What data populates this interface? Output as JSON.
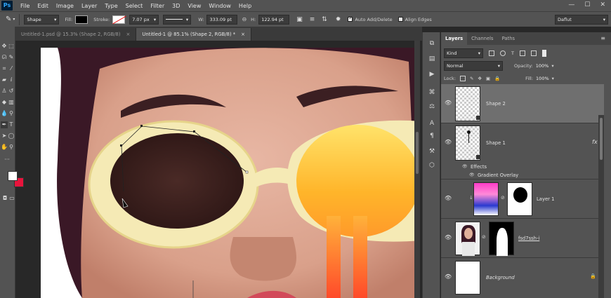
{
  "app": {
    "logo": "Ps",
    "menu": [
      "File",
      "Edit",
      "Image",
      "Layer",
      "Type",
      "Select",
      "Filter",
      "3D",
      "View",
      "Window",
      "Help"
    ],
    "window_controls": [
      "—",
      "☐",
      "✕"
    ]
  },
  "options_bar": {
    "tool_mode": "Shape",
    "fill_label": "Fill:",
    "fill_color": "#000000",
    "stroke_label": "Stroke:",
    "stroke_width": "7.07 px",
    "w_label": "W:",
    "w_value": "333.09 pt",
    "h_label": "H:",
    "h_value": "122.94 pt",
    "auto_add_delete": "Auto Add/Delete",
    "align_edges": "Align Edges",
    "workspace": "Daflut"
  },
  "tabs": [
    {
      "label": "Untitled-1.psd @ 15.3% (Shape 2, RGB/8)",
      "close": "×",
      "active": false
    },
    {
      "label": "Untitled-1 @ 85.1% (Shape 2, RGB/8) *",
      "close": "×",
      "active": true
    }
  ],
  "layers_panel": {
    "tabs": [
      "Layers",
      "Channels",
      "Paths"
    ],
    "menu_icon": "≡",
    "filter_kind": "Kind",
    "blend_mode": "Normal",
    "opacity_label": "Opacity:",
    "opacity_value": "100%",
    "lock_label": "Lock:",
    "fill_label": "Fill:",
    "fill_value": "100%",
    "layers": [
      {
        "name": "Shape 2",
        "selected": true
      },
      {
        "name": "Shape 1",
        "fx": "fx",
        "effects_label": "Effects",
        "effect": "Gradient Overlay"
      },
      {
        "name": "Layer 1"
      },
      {
        "name": "fsd7ssh-i"
      },
      {
        "name": "Background"
      }
    ]
  },
  "colors": {
    "ui_panel": "#535353",
    "canvas_bg": "#282828",
    "foreground_color": "#ffffff",
    "background_color": "#e8143c",
    "gradient_top": "#ffd23a",
    "gradient_bottom": "#ff4a2a"
  }
}
